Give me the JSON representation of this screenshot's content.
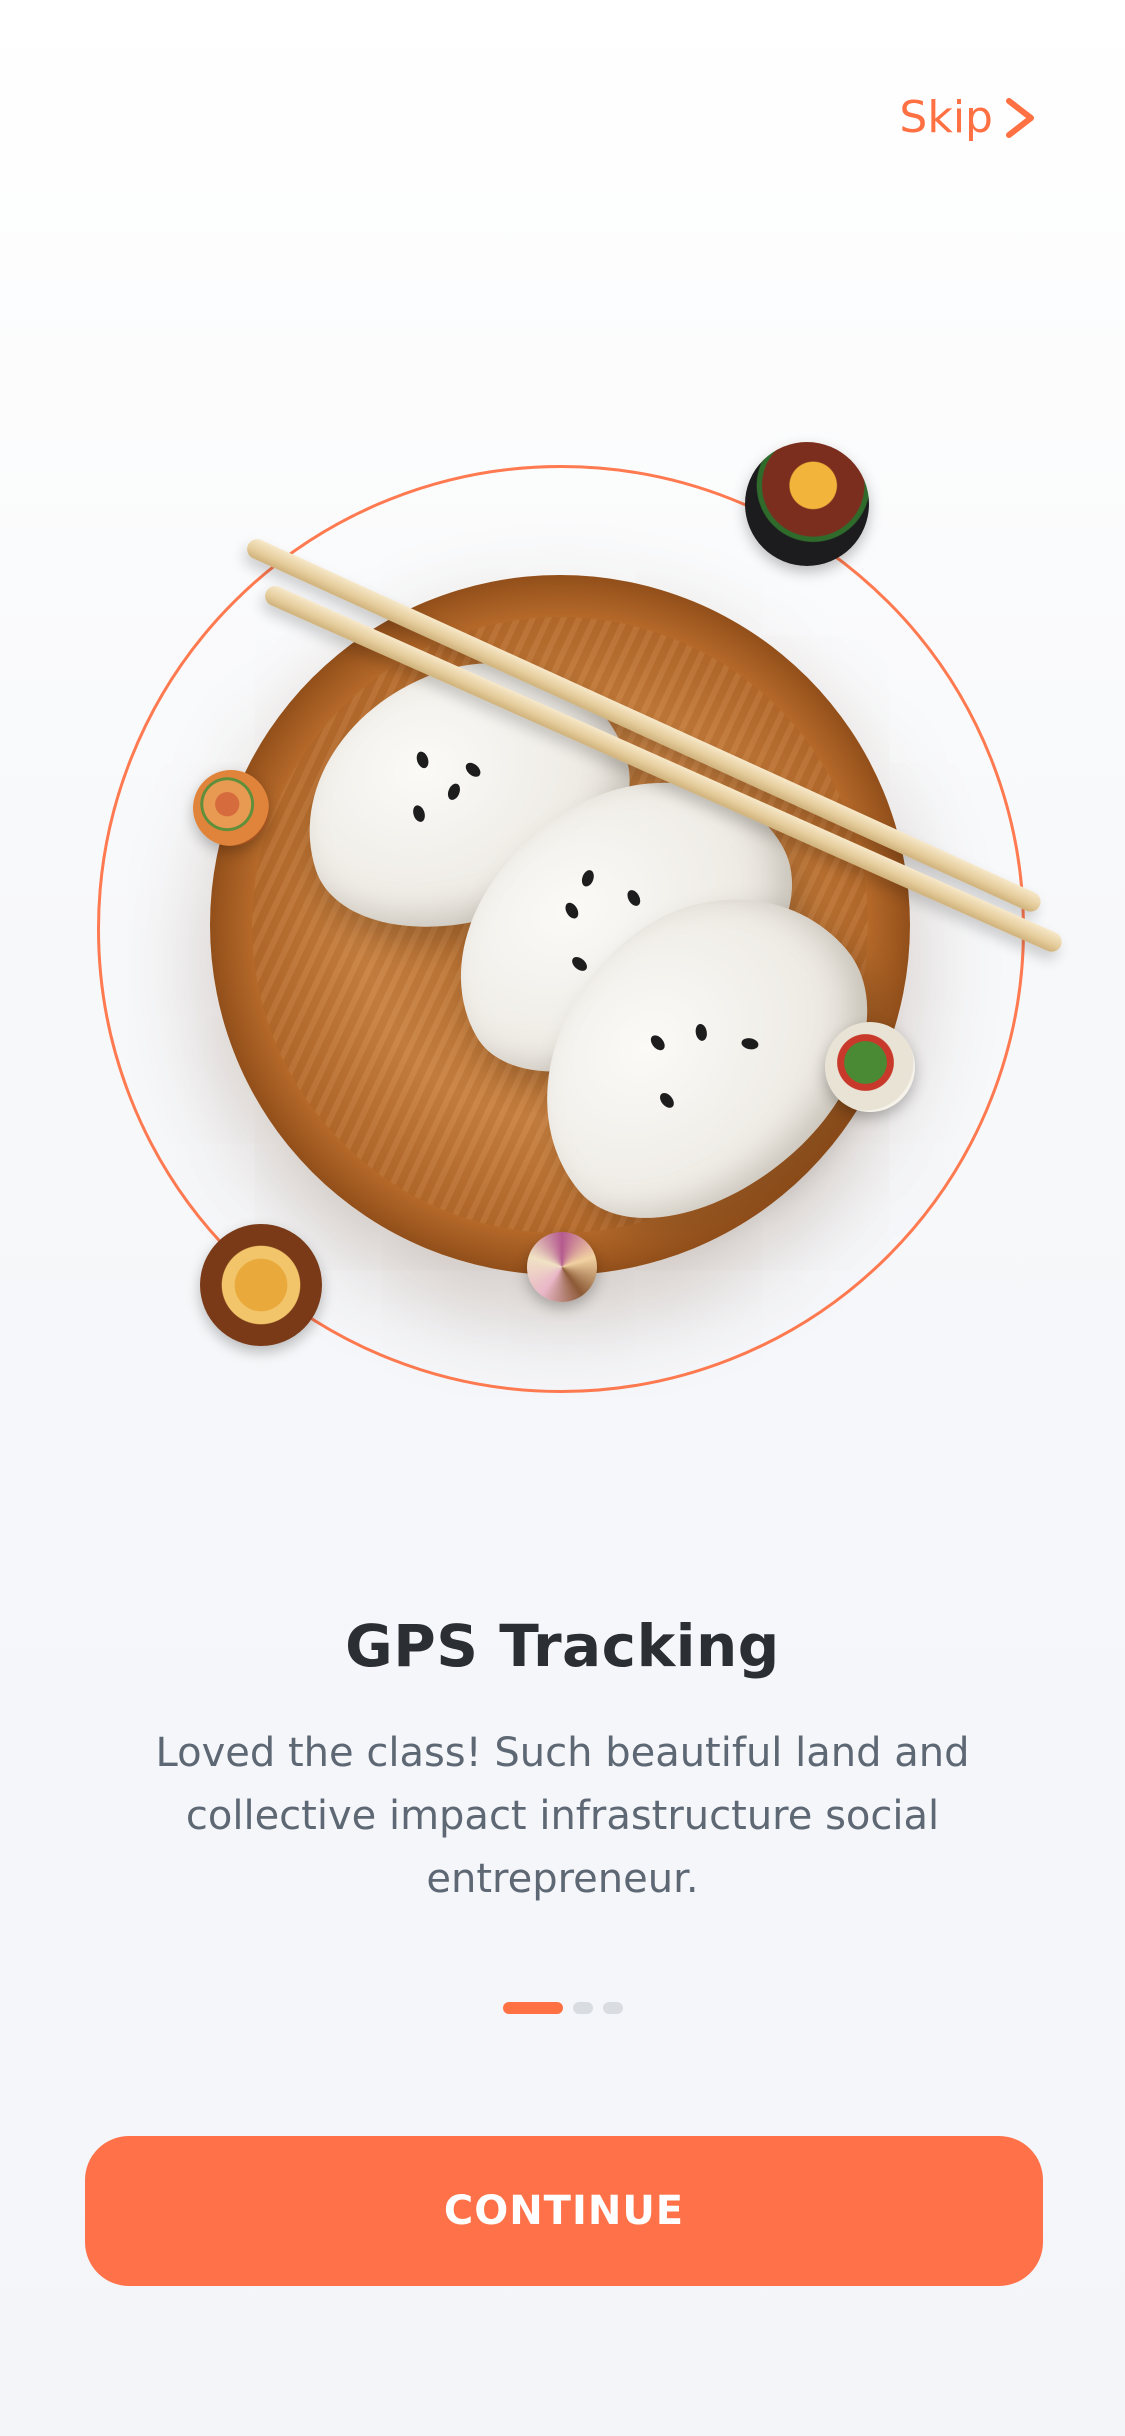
{
  "header": {
    "skip_label": "Skip"
  },
  "onboarding": {
    "title": "GPS Tracking",
    "description": "Loved the class! Such beautiful land and collective impact infrastructure social entrepreneur."
  },
  "pagination": {
    "total": 3,
    "current": 1
  },
  "cta": {
    "label": "CONTINUE"
  },
  "colors": {
    "accent": "#ff7043",
    "title": "#2b2e33",
    "body": "#5e6874"
  },
  "icons": {
    "skip": "chevron-right-icon"
  }
}
